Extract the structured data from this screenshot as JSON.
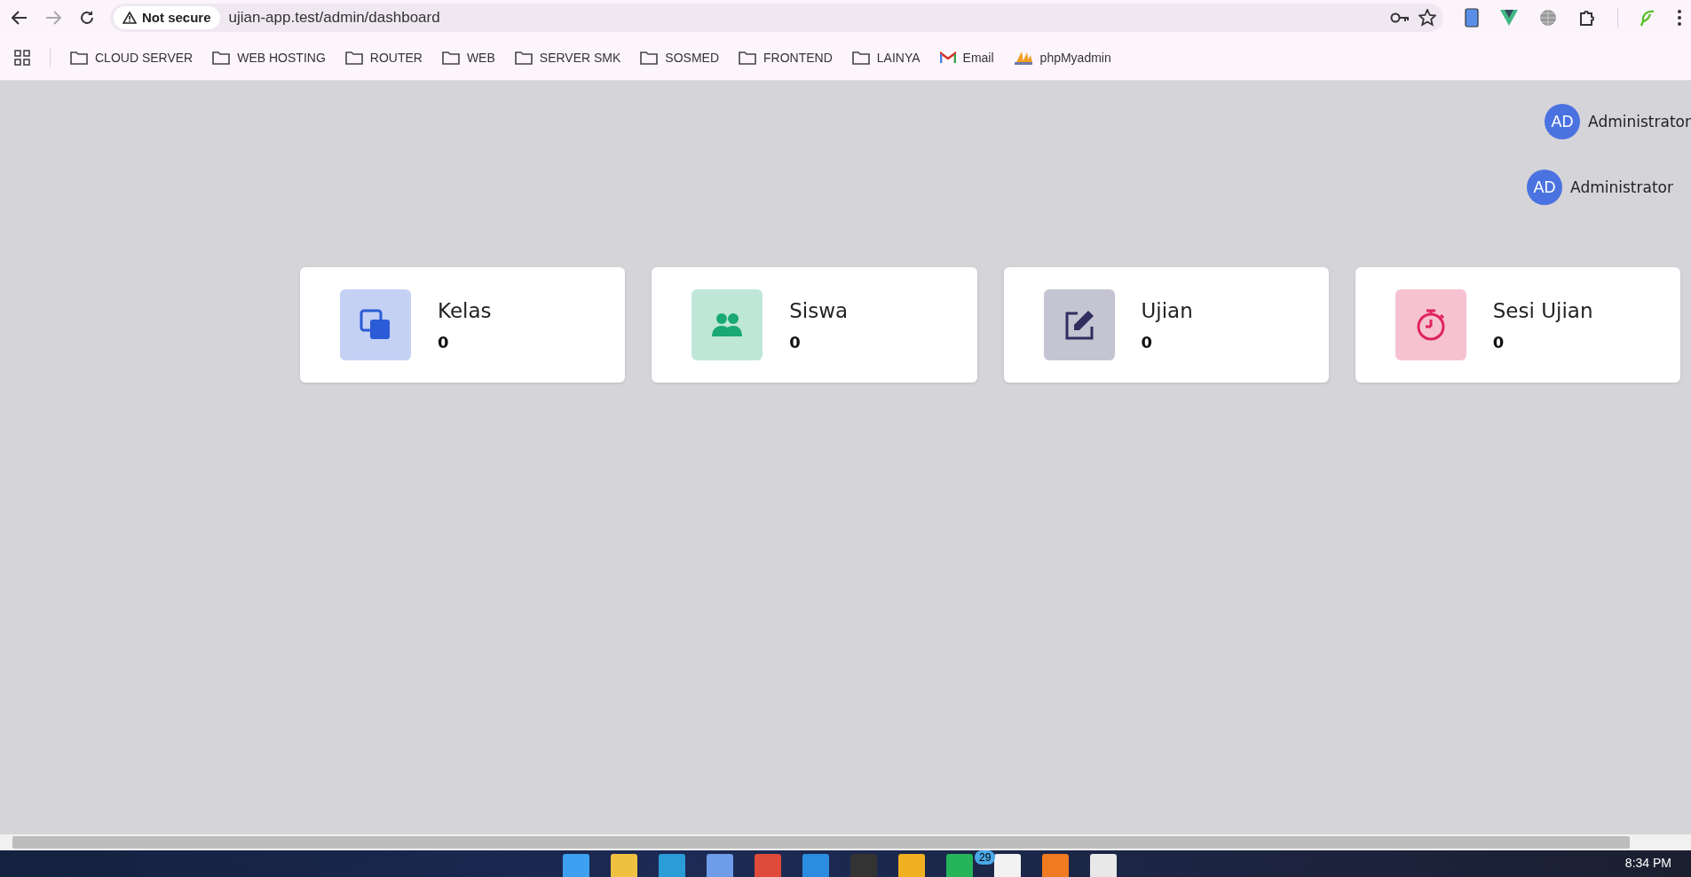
{
  "browser": {
    "security": "Not secure",
    "url": "ujian-app.test/admin/dashboard"
  },
  "bookmarks": [
    {
      "kind": "folder",
      "label": "CLOUD SERVER"
    },
    {
      "kind": "folder",
      "label": "WEB HOSTING"
    },
    {
      "kind": "folder",
      "label": "ROUTER"
    },
    {
      "kind": "folder",
      "label": "WEB"
    },
    {
      "kind": "folder",
      "label": "SERVER SMK"
    },
    {
      "kind": "folder",
      "label": "SOSMED"
    },
    {
      "kind": "folder",
      "label": "FRONTEND"
    },
    {
      "kind": "folder",
      "label": "LAINYA"
    },
    {
      "kind": "mail",
      "label": "Email"
    },
    {
      "kind": "pma",
      "label": "phpMyadmin"
    }
  ],
  "users": [
    {
      "initials": "AD",
      "name": "Administrator"
    },
    {
      "initials": "AD",
      "name": "Administrator"
    }
  ],
  "cards": [
    {
      "kind": "copy",
      "title": "Kelas",
      "value": "0",
      "color": "#2b5bd6"
    },
    {
      "kind": "users",
      "title": "Siswa",
      "value": "0",
      "color": "#1aa874"
    },
    {
      "kind": "edit",
      "title": "Ujian",
      "value": "0",
      "color": "#2f2e5f"
    },
    {
      "kind": "timer",
      "title": "Sesi Ujian",
      "value": "0",
      "color": "#e0245e"
    }
  ],
  "taskbar": {
    "badge": "29",
    "time": "8:34 PM"
  }
}
